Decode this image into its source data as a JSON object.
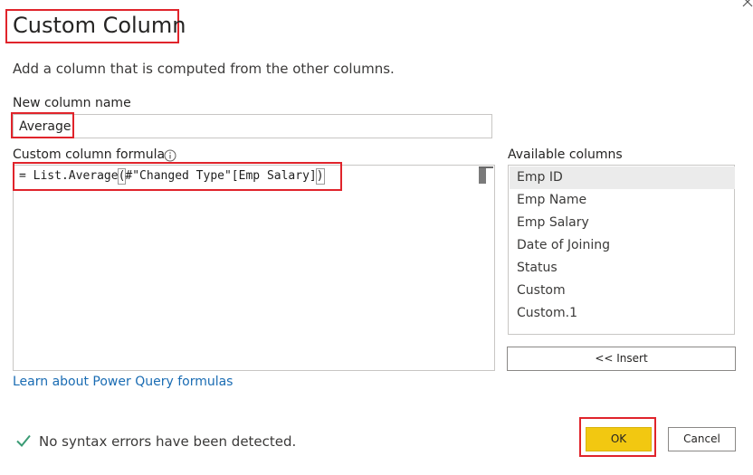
{
  "dialog": {
    "title": "Custom Column",
    "subtitle": "Add a column that is computed from the other columns."
  },
  "name_field": {
    "label": "New column name",
    "value": "Average"
  },
  "formula": {
    "label": "Custom column formula",
    "prefix": "= List.Average",
    "open_paren": "(",
    "body": "#\"Changed Type\"[Emp Salary]",
    "close_paren": ")"
  },
  "available_columns": {
    "label": "Available columns",
    "items": [
      "Emp ID",
      "Emp Name",
      "Emp Salary",
      "Date of Joining",
      "Status",
      "Custom",
      "Custom.1"
    ],
    "selected": "Emp ID"
  },
  "insert_label": "<< Insert",
  "learn_link": "Learn about Power Query formulas",
  "status": {
    "text": "No syntax errors have been detected."
  },
  "buttons": {
    "ok": "OK",
    "cancel": "Cancel"
  },
  "colors": {
    "accent": "#f2c811",
    "highlight": "#e0242b",
    "link": "#1a6cb3",
    "success": "#3a9b74"
  },
  "icons": {
    "close": "close-icon",
    "info": "info-icon",
    "check": "check-icon"
  }
}
